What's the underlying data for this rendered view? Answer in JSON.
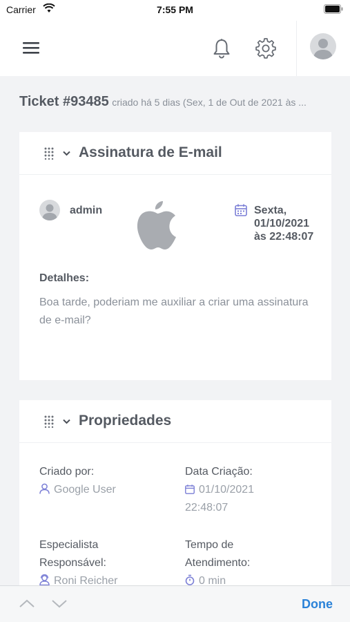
{
  "status_bar": {
    "carrier": "Carrier",
    "time": "7:55 PM"
  },
  "header": {
    "icons": [
      "menu-icon",
      "bell-icon",
      "gear-icon",
      "avatar"
    ]
  },
  "ticket": {
    "number": "Ticket #93485",
    "created": " criado há 5 dias (Sex, 1 de Out de 2021 às ..."
  },
  "message_card": {
    "title": "Assinatura de E-mail",
    "author": "admin",
    "date_line1": "Sexta,",
    "date_line2": "01/10/2021",
    "date_line3": "às 22:48:07",
    "details_label": "Detalhes:",
    "details_text": "Boa tarde, poderiam me auxiliar a criar uma assinatura de e-mail?"
  },
  "properties_card": {
    "title": "Propriedades",
    "created_by_label": "Criado por:",
    "created_by_value": "Google User",
    "creation_date_label": "Data Criação:",
    "creation_date_value": "01/10/2021",
    "creation_time_value": "22:48:07",
    "specialist_label_line1": "Especialista",
    "specialist_label_line2": "Responsável:",
    "specialist_value": "Roni Reicher",
    "service_time_label_line1": "Tempo de",
    "service_time_label_line2": "Atendimento:",
    "service_time_value": "0 min"
  },
  "accessory_bar": {
    "done_label": "Done"
  },
  "colors": {
    "accent": "#2a82d8",
    "icon_purple": "#7b7fd6",
    "background": "#f2f3f5"
  }
}
